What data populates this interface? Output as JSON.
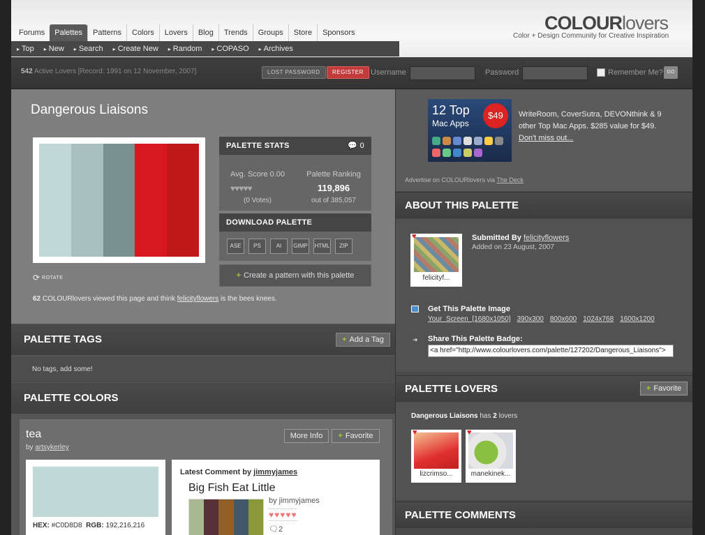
{
  "header": {
    "logo_bold": "COLOUR",
    "logo_light": "lovers",
    "tagline": "Color + Design Community for Creative Inspiration",
    "nav": [
      "Forums",
      "Palettes",
      "Patterns",
      "Colors",
      "Lovers",
      "Blog",
      "Trends",
      "Groups",
      "Store",
      "Sponsors"
    ],
    "subnav": [
      "Top",
      "New",
      "Search",
      "Create New",
      "Random",
      "COPASO",
      "Archives"
    ]
  },
  "login": {
    "active_count": "542",
    "active_text": "Active Lovers [Record: 1991 on 12 November, 2007]",
    "lost_password": "LOST PASSWORD",
    "register": "REGISTER",
    "username_label": "Username",
    "password_label": "Password",
    "remember": "Remember Me?",
    "go": "GO"
  },
  "palette": {
    "title": "Dangerous Liaisons",
    "colors": [
      "#C0D8D8",
      "#A8C0C0",
      "#789090",
      "#D81820",
      "#C01818"
    ],
    "rotate": "ROTATE",
    "viewed_count": "62",
    "viewed_text1": "COLOURlovers viewed this page and think",
    "viewed_user": "felicityflowers",
    "viewed_text2": "is the bees knees."
  },
  "stats": {
    "heading": "PALETTE STATS",
    "comments": "0",
    "avg_score": "Avg. Score 0.00",
    "hearts": "♥♥♥♥♥",
    "votes": "(0 Votes)",
    "ranking_label": "Palette Ranking",
    "ranking": "119,896",
    "out_of": "out of 385,057"
  },
  "download": {
    "heading": "DOWNLOAD PALETTE",
    "formats": [
      "ASE",
      "PS",
      "AI",
      "GIMP",
      "HTML",
      "ZIP"
    ],
    "pattern": "Create a pattern with this palette"
  },
  "tags": {
    "heading": "PALETTE TAGS",
    "add": "Add a Tag",
    "empty": "No tags, add some!"
  },
  "colors_section": {
    "heading": "PALETTE COLORS",
    "name": "tea",
    "by_label": "by",
    "by_user": "artsykerley",
    "more_info": "More Info",
    "favorite": "Favorite",
    "hex_label": "HEX:",
    "hex": "#C0D8D8",
    "rgb_label": "RGB:",
    "rgb": "192,216,216",
    "swatch": "#C0D8D8",
    "comment_label": "Latest Comment by",
    "comment_user": "jimmyjames",
    "comment_title": "Big Fish Eat Little",
    "comment_by": "by jimmyjames",
    "comment_hearts": "♥♥♥♥♥",
    "comment_count": "2",
    "mini_colors": [
      "#A8B890",
      "#5A3038",
      "#906028",
      "#405868",
      "#8A9838"
    ]
  },
  "ad": {
    "line1": "12 Top",
    "line2": "Mac Apps",
    "price": "$49",
    "text": "WriteRoom, CoverSutra, DEVONthink & 9 other Top Mac Apps. $285 value for $49.",
    "link": "Don't miss out...",
    "via": "Advertise on COLOURlovers via",
    "via_link": "The Deck"
  },
  "about": {
    "heading": "ABOUT THIS PALETTE",
    "submitted_label": "Submitted By",
    "submitted_user": "felicityflowers",
    "thumb_name": "felicityf...",
    "added": "Added on 23 August, 2007",
    "get_image": "Get This Palette Image",
    "sizes": [
      "Your Screen [1680x1050]",
      "390x300",
      "800x600",
      "1024x768",
      "1600x1200"
    ],
    "share": "Share This Palette Badge:",
    "badge": "<a href=\"http://www.colourlovers.com/palette/127202/Dangerous_Liaisons\">"
  },
  "lovers": {
    "heading": "PALETTE LOVERS",
    "favorite": "Favorite",
    "title": "Dangerous Liaisons",
    "has": "has",
    "count": "2",
    "lovers_word": "lovers",
    "names": [
      "lizcrimso...",
      "manekinek..."
    ]
  },
  "comments": {
    "heading": "PALETTE COMMENTS"
  }
}
